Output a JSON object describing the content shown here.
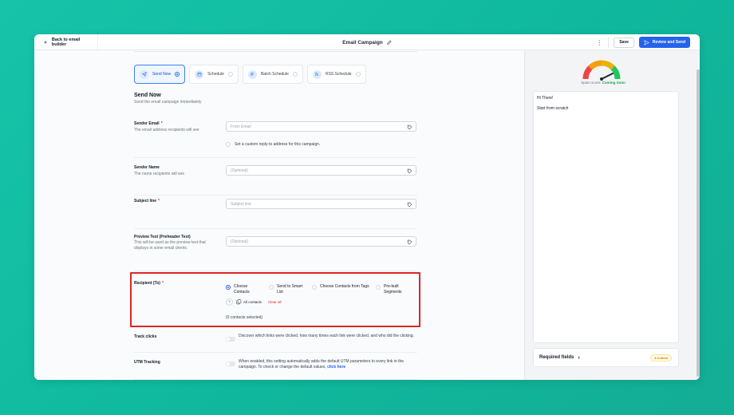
{
  "topbar": {
    "back_label": "Back to email builder",
    "title": "Email Campaign",
    "save_label": "Save",
    "review_label": "Review and Send"
  },
  "send_tabs": [
    {
      "label": "Send Now",
      "selected": true
    },
    {
      "label": "Schedule",
      "selected": false
    },
    {
      "label": "Batch Schedule",
      "selected": false
    },
    {
      "label": "RSS Schedule",
      "selected": false
    }
  ],
  "section": {
    "title": "Send Now",
    "subtitle": "Send the email campaign immediately"
  },
  "sender_email": {
    "label": "Sender Email",
    "help": "The email address recipients will see",
    "placeholder": "From Email",
    "reply_to_label": "Set a custom reply-to address for this campaign."
  },
  "sender_name": {
    "label": "Sender Name",
    "help": "The name recipients will see",
    "placeholder": "(Optional)"
  },
  "subject": {
    "label": "Subject line",
    "placeholder": "Subject line"
  },
  "preview_text": {
    "label": "Preview Text (Preheader Text)",
    "help": "This will be used as the preview text that displays in some email clients.",
    "placeholder": "(Optional)"
  },
  "recipient": {
    "label": "Recipient (To)",
    "options": [
      {
        "label": "Choose Contacts",
        "selected": true
      },
      {
        "label": "Send to Smart List",
        "selected": false
      },
      {
        "label": "Choose Contacts from Tags",
        "selected": false
      },
      {
        "label": "Pre-built Segments",
        "selected": false
      }
    ],
    "plus": "+",
    "all_contacts": "All contacts",
    "clear_all": "Clear all",
    "selected_count": "(0 contacts selected)"
  },
  "track_clicks": {
    "label": "Track clicks",
    "description": "Discover which links were clicked, how many times each link were clicked, and who did the clicking.",
    "enabled": false
  },
  "utm": {
    "label": "UTM Tracking",
    "description": "When enabled, this setting automatically adds the default UTM parameters to every link in the campaign. To check or change the default values,",
    "link": "click here",
    "enabled": false
  },
  "spam_score": {
    "label": "Spam score:",
    "value": "Coming Soon"
  },
  "preview": {
    "greeting": "Hi There!",
    "body": "Start from scratch"
  },
  "required_fields": {
    "label": "Required fields",
    "chevron": "›",
    "badge": "3 Critical"
  },
  "colors": {
    "accent": "#2563eb",
    "required": "#dc2626",
    "highlight_box": "#dc2626",
    "spam_ok": "#16a34a"
  }
}
